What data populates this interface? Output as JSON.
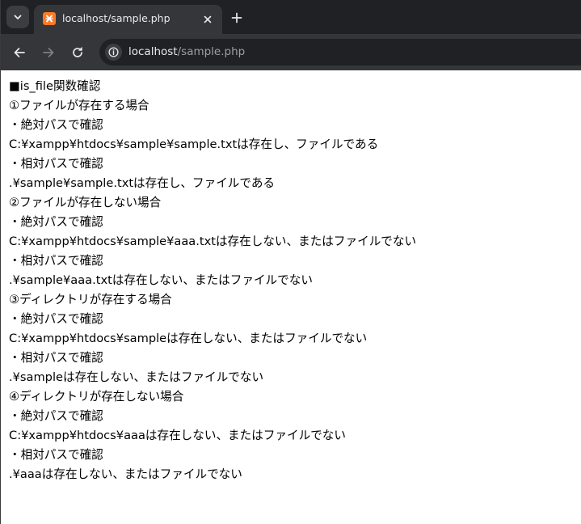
{
  "tab": {
    "title": "localhost/sample.php"
  },
  "omnibox": {
    "host": "localhost",
    "path": "/sample.php"
  },
  "colors": {
    "tabstrip_bg": "#202124",
    "toolbar_bg": "#35363a",
    "favicon_bg": "#fb7a24",
    "page_bg": "#ffffff",
    "text": "#000000"
  },
  "icons": {
    "tab_search": "chevron-down-icon",
    "favicon": "xampp-icon",
    "tab_close": "close-icon",
    "new_tab": "plus-icon",
    "back": "arrow-left-icon",
    "forward": "arrow-right-icon",
    "reload": "reload-icon",
    "site_info": "info-icon"
  },
  "content": {
    "lines": [
      "■is_file関数確認",
      "①ファイルが存在する場合",
      "・絶対パスで確認",
      "C:¥xampp¥htdocs¥sample¥sample.txtは存在し、ファイルである",
      "・相対パスで確認",
      ".¥sample¥sample.txtは存在し、ファイルである",
      "②ファイルが存在しない場合",
      "・絶対パスで確認",
      "C:¥xampp¥htdocs¥sample¥aaa.txtは存在しない、またはファイルでない",
      "・相対パスで確認",
      ".¥sample¥aaa.txtは存在しない、またはファイルでない",
      "③ディレクトリが存在する場合",
      "・絶対パスで確認",
      "C:¥xampp¥htdocs¥sampleは存在しない、またはファイルでない",
      "・相対パスで確認",
      ".¥sampleは存在しない、またはファイルでない",
      "④ディレクトリが存在しない場合",
      "・絶対パスで確認",
      "C:¥xampp¥htdocs¥aaaは存在しない、またはファイルでない",
      "・相対パスで確認",
      ".¥aaaは存在しない、またはファイルでない"
    ]
  }
}
